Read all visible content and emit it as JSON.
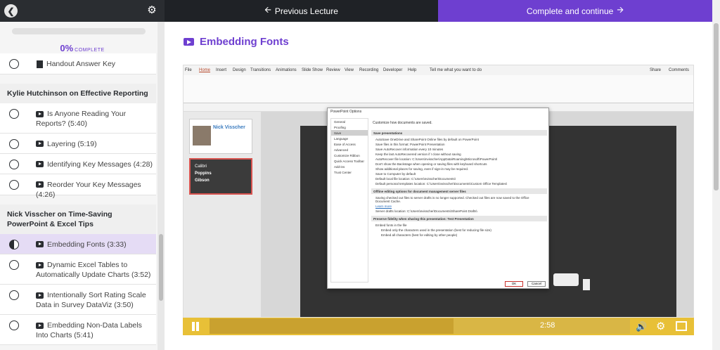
{
  "topbar": {
    "back_icon": "chevron-left-icon",
    "settings_icon": "gear-icon",
    "prev_label": "Previous Lecture",
    "complete_label": "Complete and continue"
  },
  "sidebar": {
    "progress_percent": "0%",
    "progress_text": "COMPLETE",
    "items_top": [
      {
        "label": "Handout Answer Key",
        "type": "document"
      }
    ],
    "sections": [
      {
        "title": "Kylie Hutchinson on Effective Reporting",
        "items": [
          {
            "label": "Is Anyone Reading Your Reports? (5:40)"
          },
          {
            "label": "Layering (5:19)"
          },
          {
            "label": "Identifying Key Messages (4:28)"
          },
          {
            "label": "Reorder Your Key Messages (4:26)"
          }
        ]
      },
      {
        "title": "Nick Visscher on Time-Saving PowerPoint & Excel Tips",
        "items": [
          {
            "label": "Embedding Fonts (3:33)",
            "active": true
          },
          {
            "label": "Dynamic Excel Tables to Automatically Update Charts (3:52)"
          },
          {
            "label": "Intentionally Sort Rating Scale Data in Survey DataViz (3:50)"
          },
          {
            "label": "Embedding Non-Data Labels Into Charts (5:41)"
          }
        ]
      }
    ]
  },
  "main": {
    "title": "Embedding Fonts",
    "title_icon": "video-icon"
  },
  "video": {
    "ribbon_tabs": [
      "File",
      "Home",
      "Insert",
      "Design",
      "Transitions",
      "Animations",
      "Slide Show",
      "Review",
      "View",
      "Recording",
      "Developer",
      "Help",
      "Tell me what you want to do"
    ],
    "ribbon_right": [
      "Share",
      "Comments"
    ],
    "thumb1_name": "Nick Visscher",
    "thumb2_lines": [
      "Calibri",
      "Poppins",
      "Gibson"
    ],
    "dialog": {
      "title": "PowerPoint Options",
      "nav": [
        "General",
        "Proofing",
        "Save",
        "Language",
        "Ease of Access",
        "Advanced",
        "Customize Ribbon",
        "Quick Access Toolbar",
        "Add-ins",
        "Trust Center"
      ],
      "header_text": "Customize how documents are saved.",
      "save_presentations": "Save presentations",
      "lines": [
        "AutoSave OneDrive and SharePoint Online files by default on PowerPoint",
        "Save files in this format:   PowerPoint Presentation",
        "Save AutoRecover information every  10  minutes",
        "Keep the last AutoRecovered version if I close without saving",
        "AutoRecover file location:   C:\\Users\\nvisscher\\AppData\\Roaming\\Microsoft\\PowerPoint\\",
        "Don't show the Backstage when opening or saving files with keyboard shortcuts",
        "Show additional places for saving, even if sign-in may be required.",
        "Save to Computer by default",
        "Default local file location:   C:\\Users\\nvisscher\\Documents\\",
        "Default personal templates location:   C:\\Users\\nvisscher\\Documents\\Custom Office Templates\\"
      ],
      "offline_header": "Offline editing options for document management server files",
      "offline_lines": [
        "Saving checked out files to server drafts is no longer supported. Checked out files are now saved to the Office Document Cache.",
        "Learn more",
        "Server drafts location:   C:\\Users\\nvisscher\\Documents\\SharePoint Drafts\\"
      ],
      "fidelity_header": "Preserve fidelity when sharing this presentation:   Test Presentation",
      "fidelity_lines": [
        "Embed fonts in the file",
        "Embed only the characters used in the presentation (best for reducing file size)",
        "Embed all characters (best for editing by other people)"
      ],
      "ok": "OK",
      "cancel": "Cancel"
    },
    "time": "2:58",
    "progress_fraction": 0.58
  }
}
